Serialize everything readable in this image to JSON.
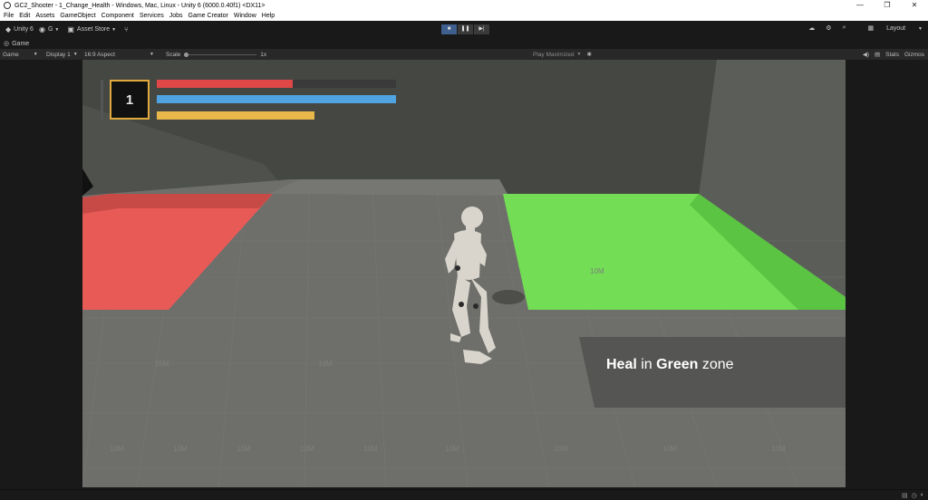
{
  "window": {
    "title": "GC2_Shooter - 1_Change_Health - Windows, Mac, Linux - Unity 6 (6000.0.40f1) <DX11>",
    "controls": [
      "—",
      "❐",
      "✕"
    ]
  },
  "menu": [
    "File",
    "Edit",
    "Assets",
    "GameObject",
    "Component",
    "Services",
    "Jobs",
    "Game Creator",
    "Window",
    "Help"
  ],
  "toolbar": {
    "unity_label": "Unity 6",
    "account_label": "G",
    "asset_store_label": "Asset Store",
    "layout_label": "Layout"
  },
  "tab": {
    "label": "Game"
  },
  "gamebar": {
    "mode": "Game",
    "display": "Display 1",
    "aspect": "16:9 Aspect",
    "scale_label": "Scale",
    "scale_value": "1x",
    "play_mode": "Play Maximized",
    "stats": "Stats",
    "gizmos": "Gizmos"
  },
  "hud": {
    "level": "1",
    "health_fraction": 0.57,
    "energy_fraction": 1.0,
    "stamina_fraction": 0.66,
    "colors": {
      "health": "#e04848",
      "energy": "#4ea3e0",
      "stamina": "#e8b84a",
      "frame": "#e0a93b"
    }
  },
  "scene": {
    "sign_words": [
      {
        "text": "Heal",
        "bold": true
      },
      {
        "text": " in ",
        "bold": false
      },
      {
        "text": "Green",
        "bold": true
      },
      {
        "text": " zone",
        "bold": false
      }
    ],
    "floor_labels": [
      "10M",
      "10M",
      "10M",
      "10M",
      "10M",
      "10M",
      "10M",
      "10M",
      "10M",
      "10M",
      "10M",
      "10M"
    ],
    "colors": {
      "damage_zone": "#e85a56",
      "heal_zone": "#72dd55",
      "floor": "#6e6f6b"
    }
  }
}
